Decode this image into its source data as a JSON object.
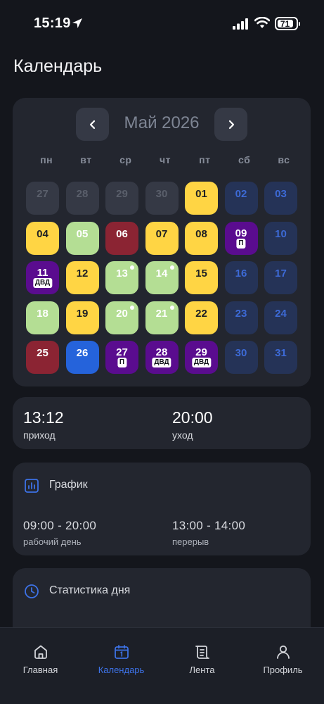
{
  "status_bar": {
    "time": "15:19",
    "battery": "71"
  },
  "page_title": "Календарь",
  "calendar": {
    "month_label": "Май 2026",
    "weekdays": [
      "пн",
      "вт",
      "ср",
      "чт",
      "пт",
      "сб",
      "вс"
    ],
    "days": [
      {
        "num": "27",
        "style": "past"
      },
      {
        "num": "28",
        "style": "past"
      },
      {
        "num": "29",
        "style": "past"
      },
      {
        "num": "30",
        "style": "past"
      },
      {
        "num": "01",
        "style": "yellow"
      },
      {
        "num": "02",
        "style": "weekend"
      },
      {
        "num": "03",
        "style": "weekend"
      },
      {
        "num": "04",
        "style": "yellow"
      },
      {
        "num": "05",
        "style": "green"
      },
      {
        "num": "06",
        "style": "red"
      },
      {
        "num": "07",
        "style": "yellow"
      },
      {
        "num": "08",
        "style": "yellow"
      },
      {
        "num": "09",
        "style": "purple",
        "tag": "П"
      },
      {
        "num": "10",
        "style": "weekend"
      },
      {
        "num": "11",
        "style": "purple",
        "tag": "ДВД"
      },
      {
        "num": "12",
        "style": "yellow"
      },
      {
        "num": "13",
        "style": "green",
        "dot": true
      },
      {
        "num": "14",
        "style": "green",
        "dot": true
      },
      {
        "num": "15",
        "style": "yellow"
      },
      {
        "num": "16",
        "style": "weekend"
      },
      {
        "num": "17",
        "style": "weekend"
      },
      {
        "num": "18",
        "style": "green"
      },
      {
        "num": "19",
        "style": "yellow"
      },
      {
        "num": "20",
        "style": "green",
        "dot": true
      },
      {
        "num": "21",
        "style": "green",
        "dot": true
      },
      {
        "num": "22",
        "style": "yellow"
      },
      {
        "num": "23",
        "style": "weekend"
      },
      {
        "num": "24",
        "style": "weekend"
      },
      {
        "num": "25",
        "style": "red"
      },
      {
        "num": "26",
        "style": "today"
      },
      {
        "num": "27",
        "style": "purple",
        "tag": "П"
      },
      {
        "num": "28",
        "style": "purple",
        "tag": "ДВД"
      },
      {
        "num": "29",
        "style": "purple",
        "tag": "ДВД"
      },
      {
        "num": "30",
        "style": "weekend"
      },
      {
        "num": "31",
        "style": "weekend"
      }
    ]
  },
  "times": {
    "arrival": "13:12",
    "arrival_label": "приход",
    "departure": "20:00",
    "departure_label": "уход"
  },
  "schedule": {
    "title": "График",
    "work_hours": "09:00 - 20:00",
    "work_label": "рабочий день",
    "break_hours": "13:00 - 14:00",
    "break_label": "перерыв"
  },
  "stats": {
    "title": "Статистика дня"
  },
  "tabs": [
    {
      "label": "Главная",
      "icon": "home-icon"
    },
    {
      "label": "Календарь",
      "icon": "calendar-icon",
      "active": true
    },
    {
      "label": "Лента",
      "icon": "feed-icon"
    },
    {
      "label": "Профиль",
      "icon": "profile-icon"
    }
  ],
  "colors": {
    "accent": "#2563db",
    "yellow": "#ffd544",
    "green": "#b4de94",
    "red": "#8b2433",
    "purple": "#5a0c8f",
    "weekend": "#253357"
  }
}
